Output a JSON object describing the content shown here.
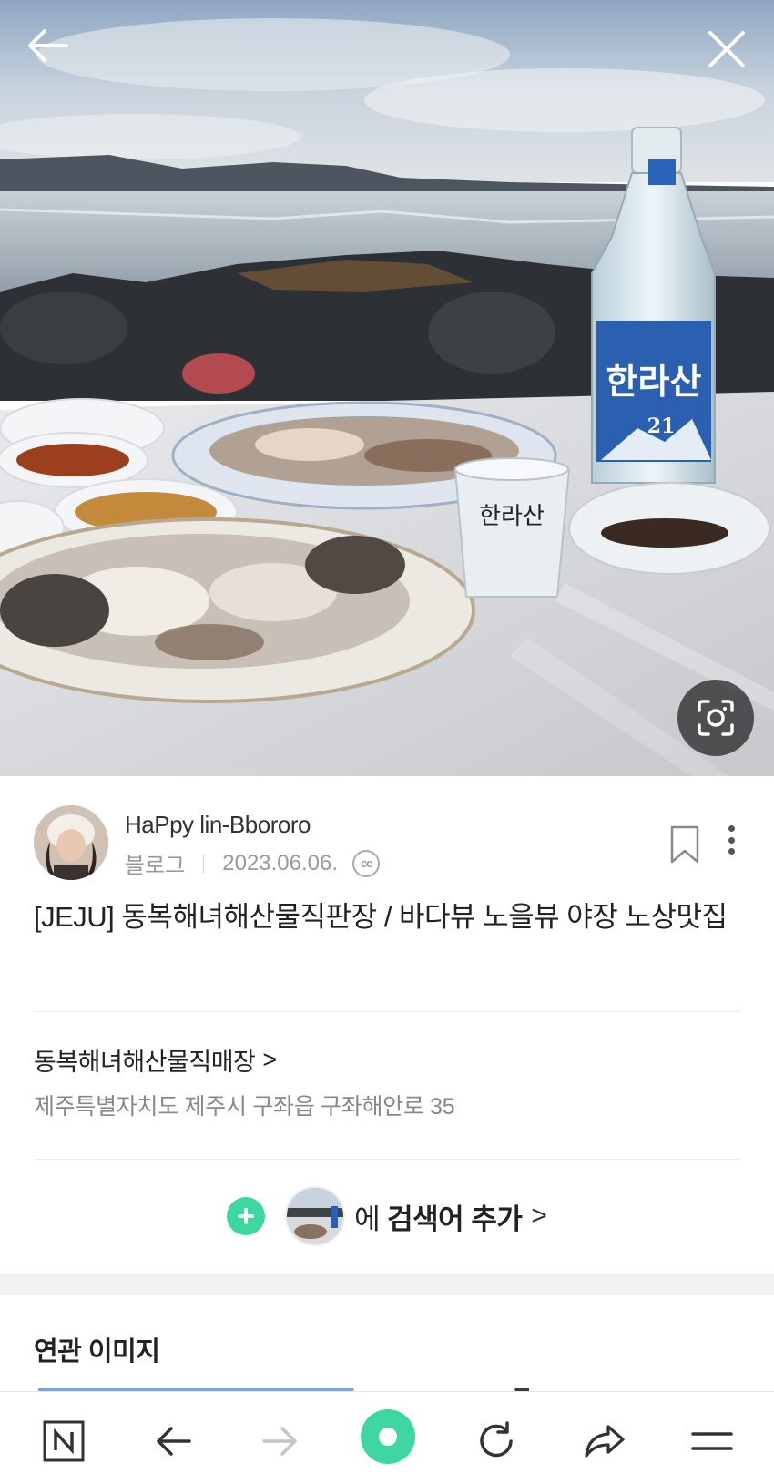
{
  "hero": {
    "bottle_label": "한라산",
    "bottle_number": "21",
    "glass_label": "한라산"
  },
  "author": {
    "name": "HaPpy lin-Bbororo",
    "source": "블로그",
    "date": "2023.06.06.",
    "license_badge": "cc"
  },
  "post": {
    "title": "[JEJU] 동복해녀해산물직판장 / 바다뷰 노을뷰 야장 노상맛집"
  },
  "place": {
    "name": "동복해녀해산물직매장",
    "chevron": ">",
    "address": "제주특별자치도 제주시 구좌읍 구좌해안로 35"
  },
  "add_search": {
    "plus": "+",
    "prefix": "에",
    "label": "검색어 추가",
    "chevron": ">"
  },
  "related": {
    "title": "연관 이미지"
  },
  "toolbar": {
    "icons": [
      "naver-home-icon",
      "back-arrow-icon",
      "forward-arrow-icon",
      "green-dot-icon",
      "reload-icon",
      "share-icon",
      "menu-icon"
    ],
    "n_label": "N"
  },
  "colors": {
    "accent_green": "#3fd7a0",
    "text_primary": "#222222",
    "text_secondary": "#888888",
    "divider": "#ececec"
  }
}
